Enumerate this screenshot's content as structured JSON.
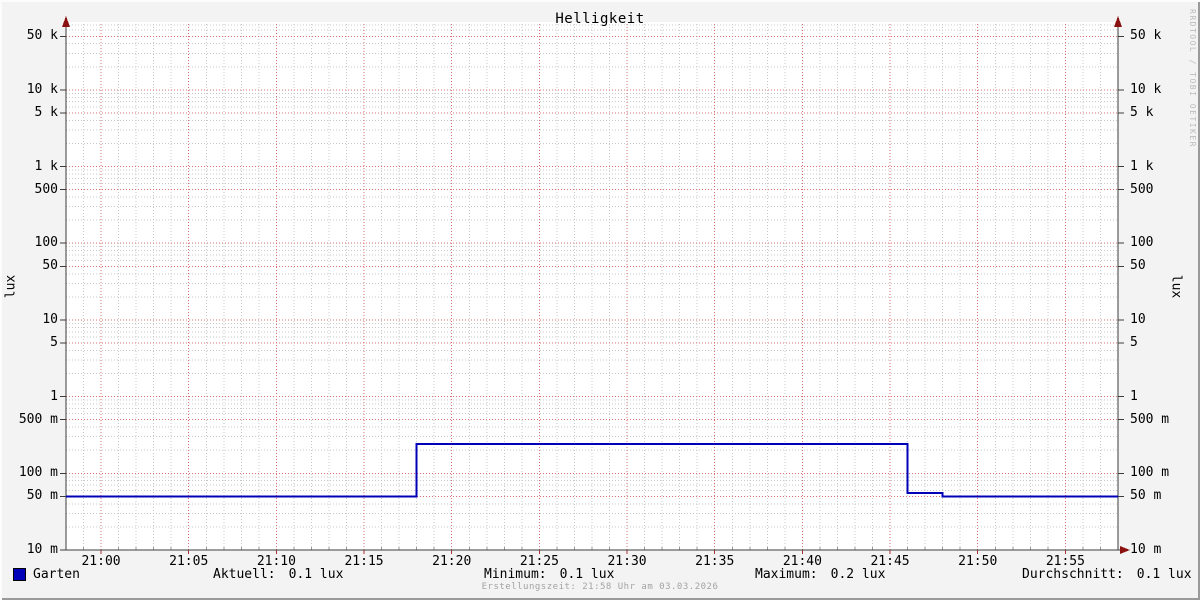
{
  "title": "Helligkeit",
  "watermark": "RRDTOOL / TOBI OETIKER",
  "footer": "Erstellungszeit: 21:58 Uhr am 03.03.2026",
  "y_axis": {
    "label_left": "lux",
    "label_right": "lux"
  },
  "legend": {
    "series_label": "Garten",
    "series_color": "#0000b8",
    "stats": [
      {
        "label": "Aktuell:",
        "value": "0.1 lux"
      },
      {
        "label": "Minimum:",
        "value": "0.1 lux"
      },
      {
        "label": "Maximum:",
        "value": "0.2 lux"
      },
      {
        "label": "Durchschnitt:",
        "value": "0.1 lux"
      }
    ]
  },
  "colors": {
    "line": "#0000b8",
    "grid_major": "#db7070",
    "grid_minor": "#c9c9c9",
    "arrow": "#8b1111",
    "background": "#f3f3f3",
    "plot_background": "#ffffff"
  },
  "chart_data": {
    "type": "line",
    "title": "Helligkeit",
    "xlabel": "",
    "ylabel": "lux",
    "y_scale": "log",
    "ylim": [
      0.01,
      76700
    ],
    "x_range": [
      "20:58",
      "21:58"
    ],
    "grid": true,
    "legend_position": "bottom",
    "y_ticks": [
      {
        "v": 50000,
        "label": "50 k"
      },
      {
        "v": 10000,
        "label": "10 k"
      },
      {
        "v": 5000,
        "label": "5 k"
      },
      {
        "v": 1000,
        "label": "1 k"
      },
      {
        "v": 500,
        "label": "500"
      },
      {
        "v": 100,
        "label": "100"
      },
      {
        "v": 50,
        "label": "50"
      },
      {
        "v": 10,
        "label": "10"
      },
      {
        "v": 5,
        "label": "5"
      },
      {
        "v": 1,
        "label": "1"
      },
      {
        "v": 0.5,
        "label": "500 m"
      },
      {
        "v": 0.1,
        "label": "100 m"
      },
      {
        "v": 0.05,
        "label": "50 m"
      },
      {
        "v": 0.01,
        "label": "10 m"
      }
    ],
    "x_ticks": [
      "21:00",
      "21:05",
      "21:10",
      "21:15",
      "21:20",
      "21:25",
      "21:30",
      "21:35",
      "21:40",
      "21:45",
      "21:50",
      "21:55"
    ],
    "series": [
      {
        "name": "Garten",
        "color": "#0000b8",
        "unit": "lux",
        "points": [
          [
            "20:58",
            0.05
          ],
          [
            "21:18",
            0.05
          ],
          [
            "21:18",
            0.24
          ],
          [
            "21:46",
            0.24
          ],
          [
            "21:46",
            0.055
          ],
          [
            "21:48",
            0.055
          ],
          [
            "21:48",
            0.05
          ],
          [
            "21:58",
            0.05
          ]
        ]
      }
    ],
    "stats": {
      "current": 0.1,
      "minimum": 0.1,
      "maximum": 0.2,
      "average": 0.1,
      "unit": "lux"
    }
  }
}
